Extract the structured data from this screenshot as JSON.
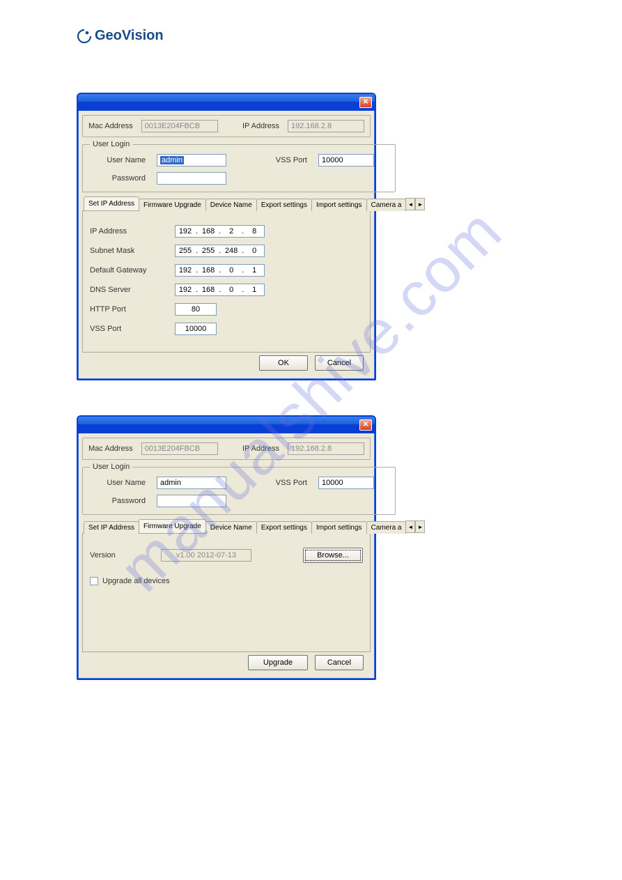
{
  "logo": {
    "text_geo": "Geo",
    "text_vision": "Vision"
  },
  "watermark": "manualshive.com",
  "dialog1": {
    "top": {
      "mac_label": "Mac Address",
      "mac_value": "0013E204FBCB",
      "ip_label": "IP Address",
      "ip_value": "192.168.2.8"
    },
    "login": {
      "legend": "User Login",
      "username_label": "User Name",
      "username_value": "admin",
      "password_label": "Password",
      "password_value": "",
      "vss_label": "VSS Port",
      "vss_value": "10000"
    },
    "tabs": {
      "items": [
        "Set IP Address",
        "Firmware Upgrade",
        "Device Name",
        "Export settings",
        "Import settings",
        "Camera a"
      ],
      "active_index": 0,
      "arrow_left": "◄",
      "arrow_right": "►"
    },
    "form": {
      "ip_label": "IP Address",
      "ip": [
        "192",
        "168",
        "2",
        "8"
      ],
      "subnet_label": "Subnet Mask",
      "subnet": [
        "255",
        "255",
        "248",
        "0"
      ],
      "gateway_label": "Default Gateway",
      "gateway": [
        "192",
        "168",
        "0",
        "1"
      ],
      "dns_label": "DNS Server",
      "dns": [
        "192",
        "168",
        "0",
        "1"
      ],
      "http_label": "HTTP Port",
      "http_value": "80",
      "vss_label": "VSS Port",
      "vss_value": "10000"
    },
    "buttons": {
      "ok": "OK",
      "cancel": "Cancel"
    }
  },
  "dialog2": {
    "top": {
      "mac_label": "Mac Address",
      "mac_value": "0013E204FBCB",
      "ip_label": "IP Address",
      "ip_value": "192.168.2.8"
    },
    "login": {
      "legend": "User Login",
      "username_label": "User Name",
      "username_value": "admin",
      "password_label": "Password",
      "password_value": "",
      "vss_label": "VSS Port",
      "vss_value": "10000"
    },
    "tabs": {
      "items": [
        "Set IP Address",
        "Firmware Upgrade",
        "Device Name",
        "Export settings",
        "Import settings",
        "Camera a"
      ],
      "active_index": 1,
      "arrow_left": "◄",
      "arrow_right": "►"
    },
    "firmware": {
      "version_label": "Version",
      "version_value": "v1.00  2012-07-13",
      "browse_label": "Browse...",
      "upgrade_all_label": "Upgrade all devices"
    },
    "buttons": {
      "upgrade": "Upgrade",
      "cancel": "Cancel"
    }
  }
}
